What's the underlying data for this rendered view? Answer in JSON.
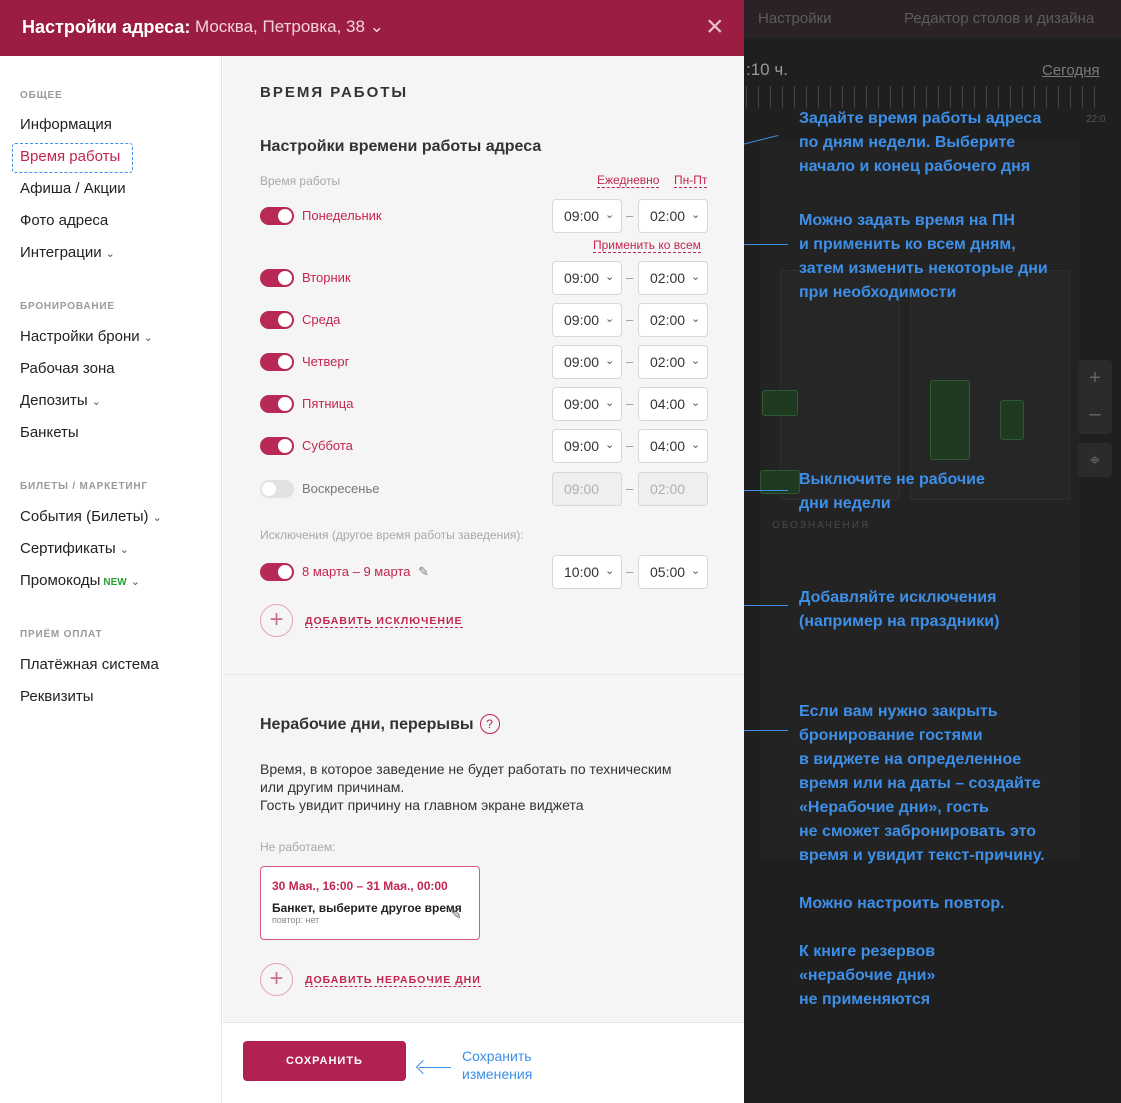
{
  "header": {
    "title": "Настройки адреса:",
    "address": "Москва, Петровка, 38 ⌄",
    "close_icon": "×"
  },
  "background": {
    "tab_settings": "Настройки",
    "tab_editor": "Редактор столов и дизайна",
    "time": ":10 ч.",
    "today": "Сегодня",
    "ruler_label": "22:0",
    "zoom_in": "+",
    "zoom_out": "–",
    "target_icon": "⌖",
    "legend": "ОБОЗНАЧЕНИЯ"
  },
  "sidebar": {
    "sections": [
      {
        "title": "ОБЩЕЕ",
        "items": [
          "Информация",
          "Время работы",
          "Афиша / Акции",
          "Фото адреса",
          "Интеграции"
        ]
      },
      {
        "title": "БРОНИРОВАНИЕ",
        "items": [
          "Настройки брони",
          "Рабочая зона",
          "Депозиты",
          "Банкеты"
        ]
      },
      {
        "title": "БИЛЕТЫ / МАРКЕТИНГ",
        "items": [
          "События (Билеты)",
          "Сертификаты",
          "Промокоды"
        ]
      },
      {
        "title": "ПРИЁМ ОПЛАТ",
        "items": [
          "Платёжная система",
          "Реквизиты"
        ]
      }
    ],
    "chevron": "⌄",
    "new_badge": "NEW"
  },
  "content": {
    "section_title": "ВРЕМЯ РАБОТЫ",
    "subtitle": "Настройки времени работы адреса",
    "hours_label": "Время работы",
    "daily_link": "Ежедневно",
    "weekdays_link": "Пн-Пт",
    "apply_all": "Применить ко всем",
    "days": [
      {
        "name": "Понедельник",
        "enabled": true,
        "from": "09:00",
        "to": "02:00"
      },
      {
        "name": "Вторник",
        "enabled": true,
        "from": "09:00",
        "to": "02:00"
      },
      {
        "name": "Среда",
        "enabled": true,
        "from": "09:00",
        "to": "02:00"
      },
      {
        "name": "Четверг",
        "enabled": true,
        "from": "09:00",
        "to": "02:00"
      },
      {
        "name": "Пятница",
        "enabled": true,
        "from": "09:00",
        "to": "04:00"
      },
      {
        "name": "Суббота",
        "enabled": true,
        "from": "09:00",
        "to": "04:00"
      },
      {
        "name": "Воскресенье",
        "enabled": false,
        "from": "09:00",
        "to": "02:00"
      }
    ],
    "exceptions_label": "Исключения (другое время работы заведения):",
    "exception": {
      "name": "8 марта – 9 марта",
      "enabled": true,
      "from": "10:00",
      "to": "05:00"
    },
    "add_exception": "ДОБАВИТЬ ИСКЛЮЧЕНИЕ",
    "nonwork_title": "Нерабочие дни, перерывы",
    "nonwork_desc": "Время, в которое заведение не будет работать по техническим\nили другим причинам.\nГость увидит причину на главном экране виджета",
    "nonwork_label": "Не работаем:",
    "card": {
      "dates": "30 Мая., 16:00 – 31 Мая., 00:00",
      "reason": "Банкет, выберите другое время",
      "repeat": "повтор: нет"
    },
    "add_nonwork": "ДОБАВИТЬ НЕРАБОЧИЕ ДНИ",
    "plus": "+",
    "dash": "–",
    "chev": "⌄",
    "question": "?",
    "pencil": "✎"
  },
  "footer": {
    "save": "СОХРАНИТЬ",
    "save_note": "Сохранить\nизменения"
  },
  "annotations": [
    "Задайте время работы адреса\nпо дням недели. Выберите\nначало и конец рабочего дня",
    "Можно задать время на ПН\nи применить ко всем дням,\nзатем изменить некоторые дни\nпри необходимости",
    "Выключите не рабочие\nдни недели",
    "Добавляйте исключения\n(например на праздники)",
    "Если вам нужно закрыть\nбронирование гостями\nв виджете на определенное\nвремя или на даты – создайте\n«Нерабочие дни», гость\nне сможет забронировать это\nвремя и увидит текст-причину.\n\nМожно настроить повтор.\n\nК книге резервов\n«нерабочие дни»\nне применяются"
  ],
  "colors": {
    "brand": "#9c1d42",
    "accent": "#c3264f",
    "annotation": "#3d8fe8"
  }
}
